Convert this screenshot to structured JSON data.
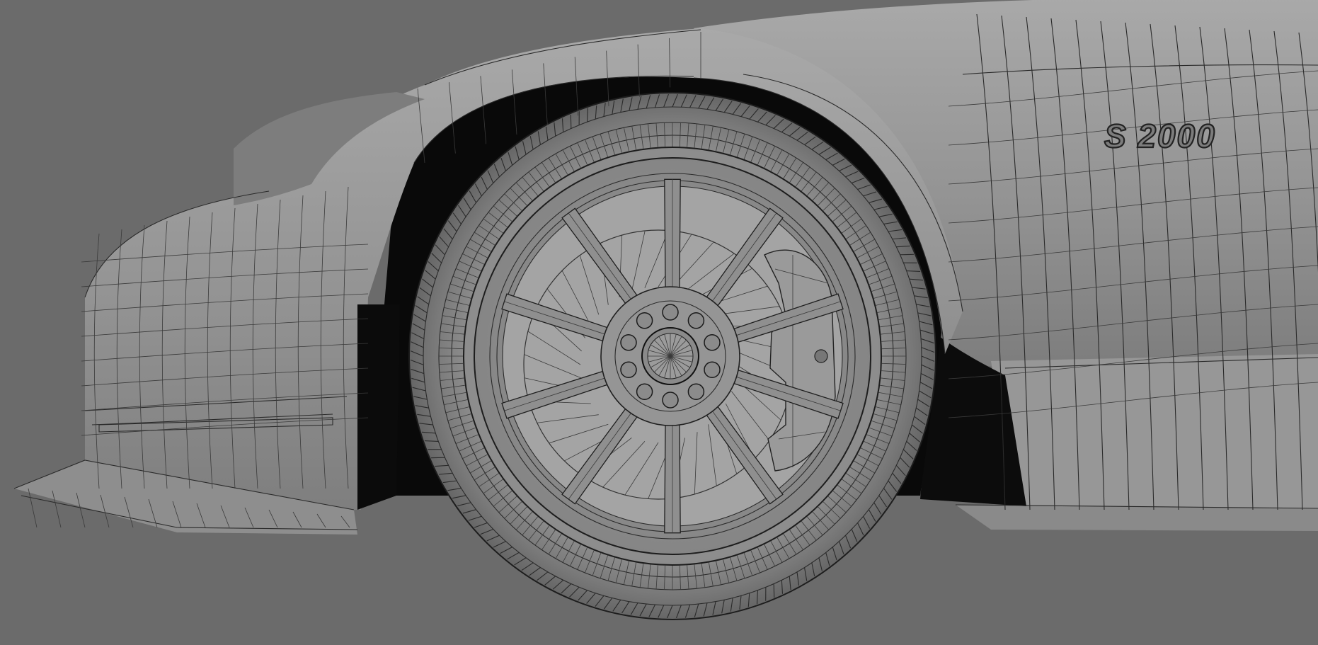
{
  "scene": {
    "badge_label": "S 2000"
  },
  "colors": {
    "background": "#6b6b6b",
    "body_shade": "#9a9a9a",
    "wire": "#2a2a2a",
    "shadow": "#0a0a0a"
  },
  "icons": [
    "car-body-wireframe",
    "wheel-wireframe",
    "brake-caliper",
    "badge"
  ]
}
